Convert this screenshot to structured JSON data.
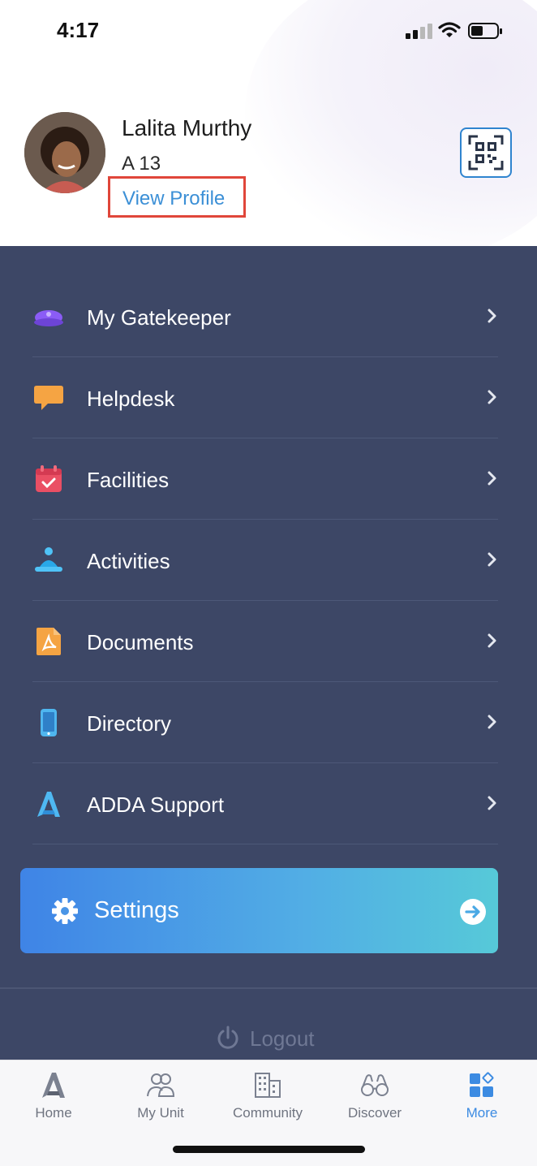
{
  "status_bar": {
    "time": "4:17",
    "signal_icon": "cellular-signal-icon",
    "wifi_icon": "wifi-icon",
    "battery_icon": "battery-icon"
  },
  "profile": {
    "name": "Lalita Murthy",
    "unit": "A 13",
    "view_profile_label": "View Profile",
    "avatar_icon": "user-avatar",
    "qr_icon": "qr-code-icon"
  },
  "menu": {
    "items": [
      {
        "label": "My Gatekeeper",
        "icon": "gatekeeper-cap-icon"
      },
      {
        "label": "Helpdesk",
        "icon": "chat-bubble-icon"
      },
      {
        "label": "Facilities",
        "icon": "calendar-check-icon"
      },
      {
        "label": "Activities",
        "icon": "activities-person-icon"
      },
      {
        "label": "Documents",
        "icon": "pdf-document-icon"
      },
      {
        "label": "Directory",
        "icon": "phone-icon"
      },
      {
        "label": "ADDA Support",
        "icon": "adda-logo-icon"
      }
    ],
    "settings_label": "Settings",
    "logout_label": "Logout"
  },
  "tabbar": {
    "tabs": [
      {
        "label": "Home",
        "icon": "adda-home-icon"
      },
      {
        "label": "My Unit",
        "icon": "people-icon"
      },
      {
        "label": "Community",
        "icon": "building-icon"
      },
      {
        "label": "Discover",
        "icon": "binoculars-icon"
      },
      {
        "label": "More",
        "icon": "grid-more-icon",
        "active": true
      }
    ]
  },
  "colors": {
    "menu_background": "#3d4766",
    "accent_blue": "#3c8be2",
    "highlight_border": "#e0463a",
    "settings_gradient_start": "#3f84e6",
    "settings_gradient_end": "#56c9d8"
  }
}
